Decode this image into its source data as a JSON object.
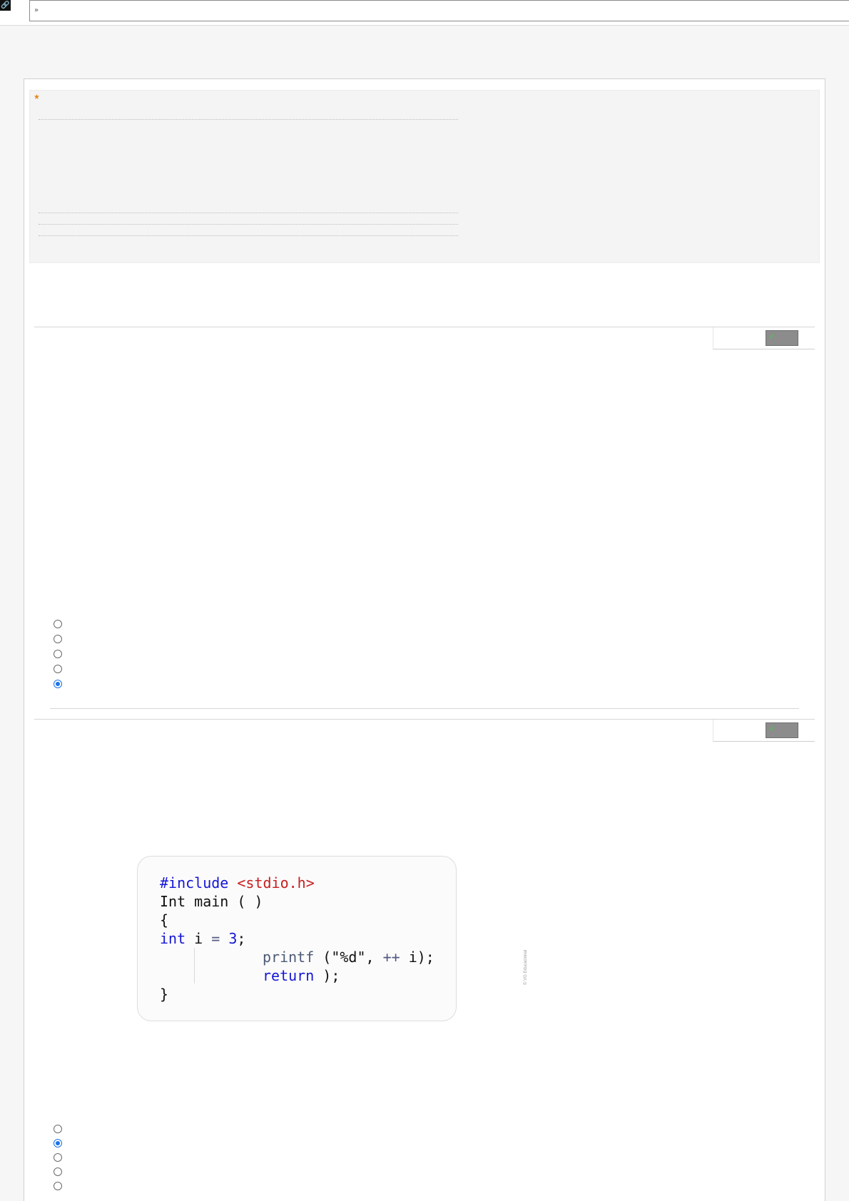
{
  "topbar": {
    "corner_icon": "link-icon",
    "url_chevron_icon": "double-chevron-down-icon",
    "url_value": ""
  },
  "info_box": {
    "star_icon": "star-icon",
    "accent_color": "#e08a1e"
  },
  "questions": [
    {
      "status_icon": "checkmark-icon",
      "status_badge_color": "#8c8c8c",
      "options_selected_index": 4,
      "options_count": 5
    },
    {
      "status_icon": "checkmark-icon",
      "status_badge_color": "#8c8c8c",
      "options_selected_index": 1,
      "options_count": 5,
      "code": {
        "line1_kw": "#include",
        "line1_str": "<stdio.h>",
        "line2": "Int main ( )",
        "line3": "{",
        "line4_kw": "int",
        "line4_rest": " i ",
        "line4_op": "=",
        "line4_num": "3",
        "line4_end": ";",
        "line5_fn": "printf",
        "line5_rest": " (\"%d\", ",
        "line5_op": "++",
        "line5_end": " i);",
        "line6_kw": "return",
        "line6_end": " );",
        "line7": "}"
      },
      "watermark": "© VG Educacional"
    }
  ],
  "colors": {
    "radio_selected": "#1a73e8",
    "keyword": "#1515d6",
    "string": "#c81e1e"
  }
}
